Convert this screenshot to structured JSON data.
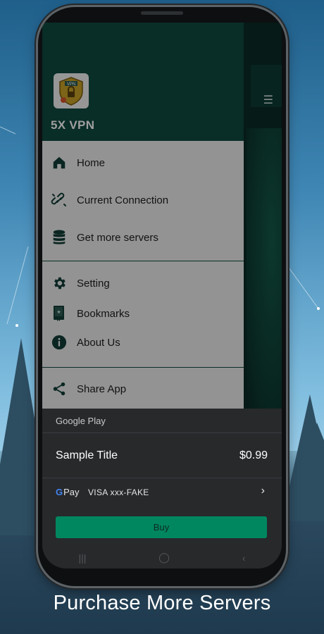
{
  "drawer": {
    "app_name": "5X VPN",
    "logo_text": "VPN",
    "items": [
      {
        "label": "Home",
        "icon": "home-icon"
      },
      {
        "label": "Current Connection",
        "icon": "broken-link-icon"
      },
      {
        "label": "Get more servers",
        "icon": "database-icon"
      },
      {
        "label": "Setting",
        "icon": "gear-icon"
      },
      {
        "label": "Bookmarks",
        "icon": "bookmark-book-icon"
      },
      {
        "label": "About Us",
        "icon": "info-icon"
      },
      {
        "label": "Share App",
        "icon": "share-icon"
      }
    ]
  },
  "purchase": {
    "provider": "Google Play",
    "title": "Sample Title",
    "price": "$0.99",
    "pay_brand": "Pay",
    "card": "VISA xxx-FAKE",
    "buy_label": "Buy"
  },
  "caption": "Purchase More Servers",
  "colors": {
    "drawer_header": "#0f4a40",
    "buy_button": "#01875f",
    "sheet_bg": "#27292b"
  }
}
